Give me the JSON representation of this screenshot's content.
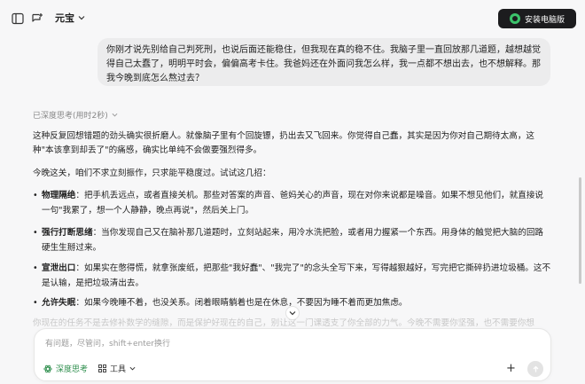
{
  "header": {
    "model_label": "元宝",
    "install_label": "安装电脑版"
  },
  "user_message": "你刚才说先别给自己判死刑，也说后面还能稳住，但我现在真的稳不住。我脑子里一直回放那几道题，越想越觉得自己太蠢了，明明平时会，偏偏高考卡住。我爸妈还在外面问我怎么样，我一点都不想出去，也不想解释。那我今晚到底怎么熬过去？",
  "thinking": {
    "label": "已深度思考(用时2秒)"
  },
  "answer": {
    "p1": "这种反复回想错题的劲头确实很折磨人。就像脑子里有个回旋镖，扔出去又飞回来。你觉得自己蠢，其实是因为你对自己期待太高，这种\"本该拿到却丢了\"的痛感，确实比单纯不会做要强烈得多。",
    "p2": "今晚这关，咱们不求立刻振作，只求能平稳度过。试试这几招：",
    "bullets": [
      {
        "title": "物理隔绝",
        "text": "：把手机丢远点，或者直接关机。那些对答案的声音、爸妈关心的声音，现在对你来说都是噪音。如果不想见他们，就直接说一句\"我累了，想一个人静静，晚点再说\"，然后关上门。"
      },
      {
        "title": "强行打断思绪",
        "text": "：当你发现自己又在脑补那几道题时，立刻站起来，用冷水洗把脸，或者用力握紧一个东西。用身体的触觉把大脑的回路硬生生掰过来。"
      },
      {
        "title": "宣泄出口",
        "text": "：如果实在憋得慌，就拿张废纸，把那些\"我好蠢\"、\"我完了\"的念头全写下来，写得越狠越好，写完把它撕碎扔进垃圾桶。这不是认输，是把垃圾清出去。"
      },
      {
        "title": "允许失眠",
        "text": "：如果今晚睡不着，也没关系。闭着眼睛躺着也是在休息，不要因为睡不着而更加焦虑。"
      }
    ],
    "faded": "你现在的任务不是去修补数学的缝隙，而是保护好现在的自己，别让这一门课透支了你全部的力气。今晚不需要你坚强，也不需要你想"
  },
  "composer": {
    "placeholder": "有问题，尽管问，shift+enter换行",
    "deep_think_label": "深度思考",
    "tools_label": "工具"
  },
  "colors": {
    "accent_green": "#2f8f4e",
    "install_bg": "#1c1c1e",
    "bubble_bg": "#ececed"
  }
}
